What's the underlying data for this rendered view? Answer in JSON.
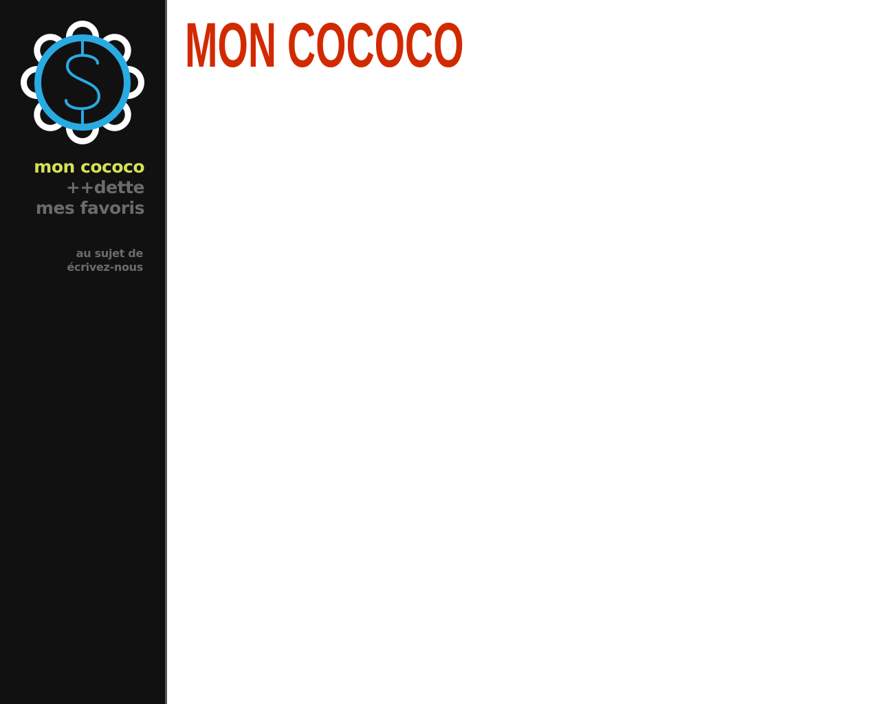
{
  "logo": {
    "icon": "dollar-flower-logo-icon",
    "glyph": "$",
    "ring_color": "#29abe2",
    "petal_color": "#ffffff"
  },
  "nav": {
    "items": [
      {
        "label": "mon cococo",
        "active": true
      },
      {
        "label": "++dette",
        "active": false
      },
      {
        "label": "mes favoris",
        "active": false
      }
    ],
    "secondary": [
      {
        "label": "au sujet de"
      },
      {
        "label": "écrivez-nous"
      }
    ]
  },
  "main": {
    "title": "MON COCOCO"
  },
  "colors": {
    "sidebar_bg": "#111111",
    "active_nav": "#d4e157",
    "inactive_nav": "#6b6b6b",
    "title": "#d22a00"
  }
}
